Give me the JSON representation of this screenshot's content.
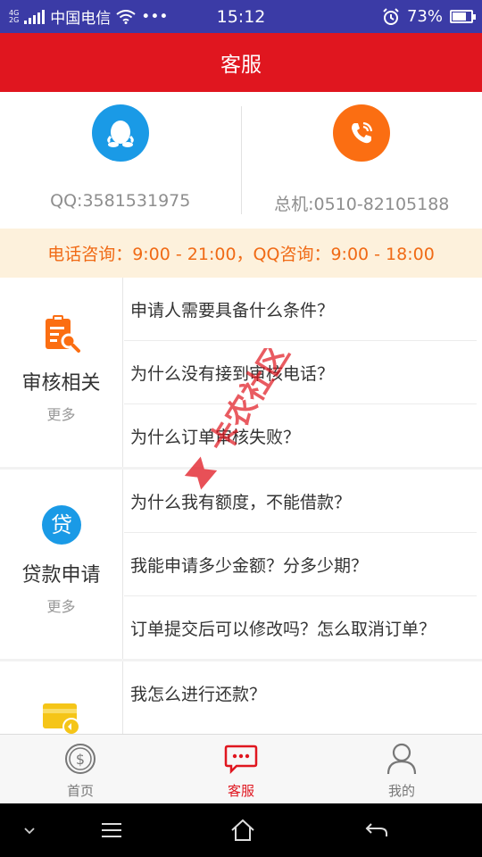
{
  "status_bar": {
    "net_top": "4G",
    "net_bottom": "2G",
    "carrier": "中国电信",
    "dots": "•••",
    "time": "15:12",
    "battery": "73%",
    "battery_level": 0.73
  },
  "header": {
    "title": "客服"
  },
  "contact": {
    "qq": "QQ:3581531975",
    "phone": "总机:0510-82105188"
  },
  "hours": "电话咨询：9:00 - 21:00，QQ咨询：9:00 - 18:00",
  "faq": [
    {
      "category": "审核相关",
      "more": "更多",
      "questions": [
        "申请人需要具备什么条件？",
        "为什么没有接到审核电话？",
        "为什么订单审核失败？"
      ]
    },
    {
      "category": "贷款申请",
      "more": "更多",
      "questions": [
        "为什么我有额度，不能借款？",
        "我能申请多少金额？分多少期？",
        "订单提交后可以修改吗？怎么取消订单？"
      ]
    },
    {
      "questions": [
        "我怎么进行还款？"
      ]
    }
  ],
  "loan_icon_char": "贷",
  "watermark_text": "卡农社区",
  "tabs": [
    {
      "label": "首页",
      "icon": "dollar-coin-icon"
    },
    {
      "label": "客服",
      "icon": "chat-bubble-icon",
      "active": true
    },
    {
      "label": "我的",
      "icon": "person-icon"
    }
  ],
  "colors": {
    "header": "#e0161f",
    "status_bar": "#3b3ba6",
    "hours_text": "#f06a15",
    "hours_bg": "#fdf1dc",
    "qq_blue": "#1a9ae6",
    "phone_orange": "#fb6e12"
  }
}
